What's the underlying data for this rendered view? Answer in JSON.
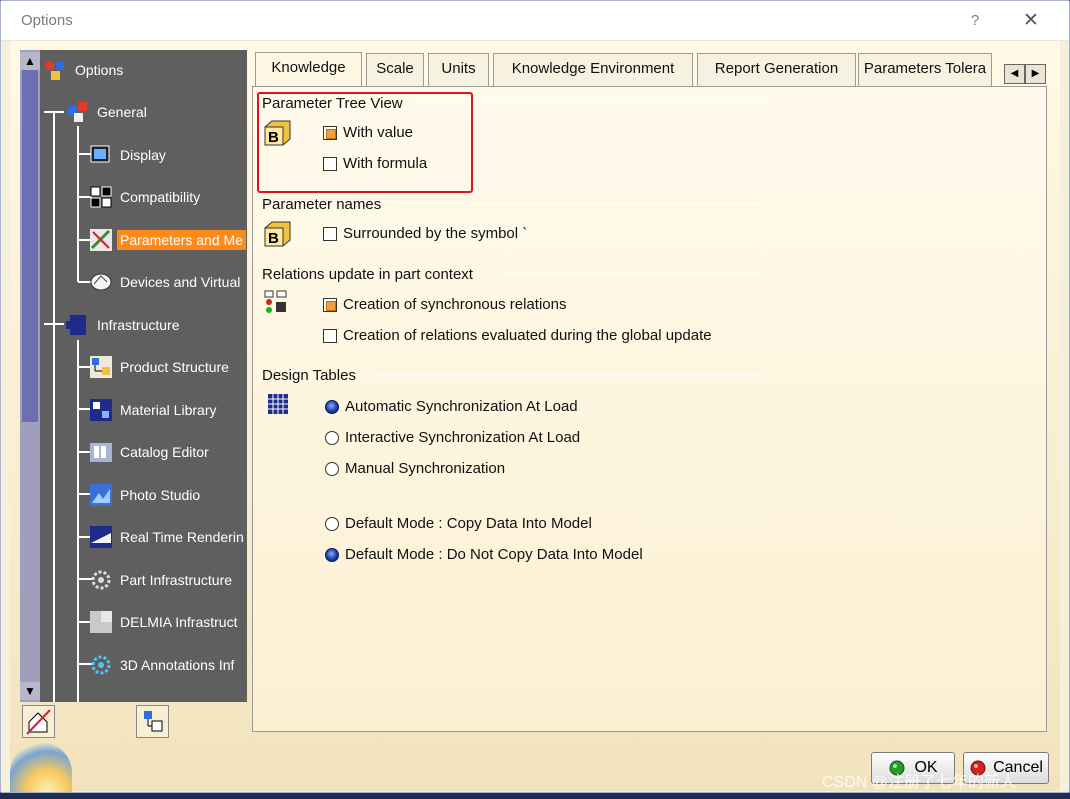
{
  "window": {
    "title": "Options",
    "help": "?",
    "close": "✕"
  },
  "tree": {
    "items": [
      {
        "label": "Options",
        "selected": false
      },
      {
        "label": "General",
        "selected": false
      },
      {
        "label": "Display",
        "selected": false
      },
      {
        "label": "Compatibility",
        "selected": false
      },
      {
        "label": "Parameters and Me",
        "selected": true
      },
      {
        "label": "Devices and Virtual",
        "selected": false
      },
      {
        "label": "Infrastructure",
        "selected": false
      },
      {
        "label": "Product Structure",
        "selected": false
      },
      {
        "label": "Material Library",
        "selected": false
      },
      {
        "label": "Catalog Editor",
        "selected": false
      },
      {
        "label": "Photo Studio",
        "selected": false
      },
      {
        "label": "Real Time Renderin",
        "selected": false
      },
      {
        "label": "Part Infrastructure",
        "selected": false
      },
      {
        "label": "DELMIA Infrastruct",
        "selected": false
      },
      {
        "label": "3D Annotations Inf",
        "selected": false
      }
    ],
    "scroll_up": "▲",
    "scroll_down": "▼"
  },
  "tabs": [
    "Knowledge",
    "Scale",
    "Units",
    "Knowledge Environment",
    "Report Generation",
    "Parameters Tolera"
  ],
  "tab_scroll": {
    "left": "◀",
    "right": "▶"
  },
  "sections": {
    "parameter_tree_view": {
      "title": "Parameter Tree View",
      "options": [
        {
          "label": "With value",
          "checked": true
        },
        {
          "label": "With formula",
          "checked": false
        }
      ]
    },
    "parameter_names": {
      "title": "Parameter names",
      "options": [
        {
          "label": "Surrounded by the symbol `",
          "checked": false
        }
      ]
    },
    "relations_update": {
      "title": "Relations update in part context",
      "options": [
        {
          "label": "Creation of synchronous relations",
          "checked": true
        },
        {
          "label": "Creation of relations evaluated during the global update",
          "checked": false
        }
      ]
    },
    "design_tables": {
      "title": "Design Tables",
      "sync": [
        {
          "label": "Automatic Synchronization At Load",
          "selected": true
        },
        {
          "label": "Interactive Synchronization At Load",
          "selected": false
        },
        {
          "label": "Manual Synchronization",
          "selected": false
        }
      ],
      "mode": [
        {
          "label": "Default Mode : Copy Data Into Model",
          "selected": false
        },
        {
          "label": "Default Mode : Do Not Copy Data Into Model",
          "selected": true
        }
      ]
    }
  },
  "buttons": {
    "ok": "OK",
    "cancel": "Cancel"
  },
  "watermark": "CSDN @注册了七年的新人",
  "colors": {
    "selection": "#ff8a1a",
    "highlight_box": "#e0121b",
    "radio_on": "#1b3da8",
    "check_on": "#f0a03c"
  }
}
